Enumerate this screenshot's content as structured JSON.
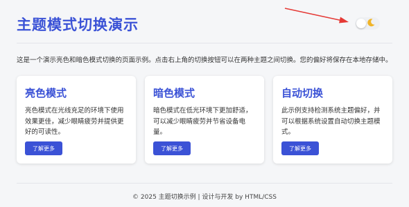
{
  "header": {
    "title": "主题模式切换演示",
    "toggle_state": "off",
    "toggle_icon": "moon-icon"
  },
  "intro": "这是一个演示亮色和暗色模式切换的页面示例。点击右上角的切换按钮可以在两种主题之间切换。您的偏好将保存在本地存储中。",
  "cards": [
    {
      "title": "亮色模式",
      "text": "亮色模式在光线充足的环境下使用效果更佳，减少眼睛疲劳并提供更好的可读性。",
      "button": "了解更多"
    },
    {
      "title": "暗色模式",
      "text": "暗色模式在低光环境下更加舒适，可以减少眼睛疲劳并节省设备电量。",
      "button": "了解更多"
    },
    {
      "title": "自动切换",
      "text": "此示例支持检测系统主题偏好，并可以根据系统设置自动切换主题模式。",
      "button": "了解更多"
    }
  ],
  "footer": "© 2025 主题切换示例 | 设计与开发 by HTML/CSS",
  "colors": {
    "accent": "#3b52d6",
    "background": "#f5f6f8",
    "arrow": "#e53935",
    "moon": "#f0b429"
  }
}
